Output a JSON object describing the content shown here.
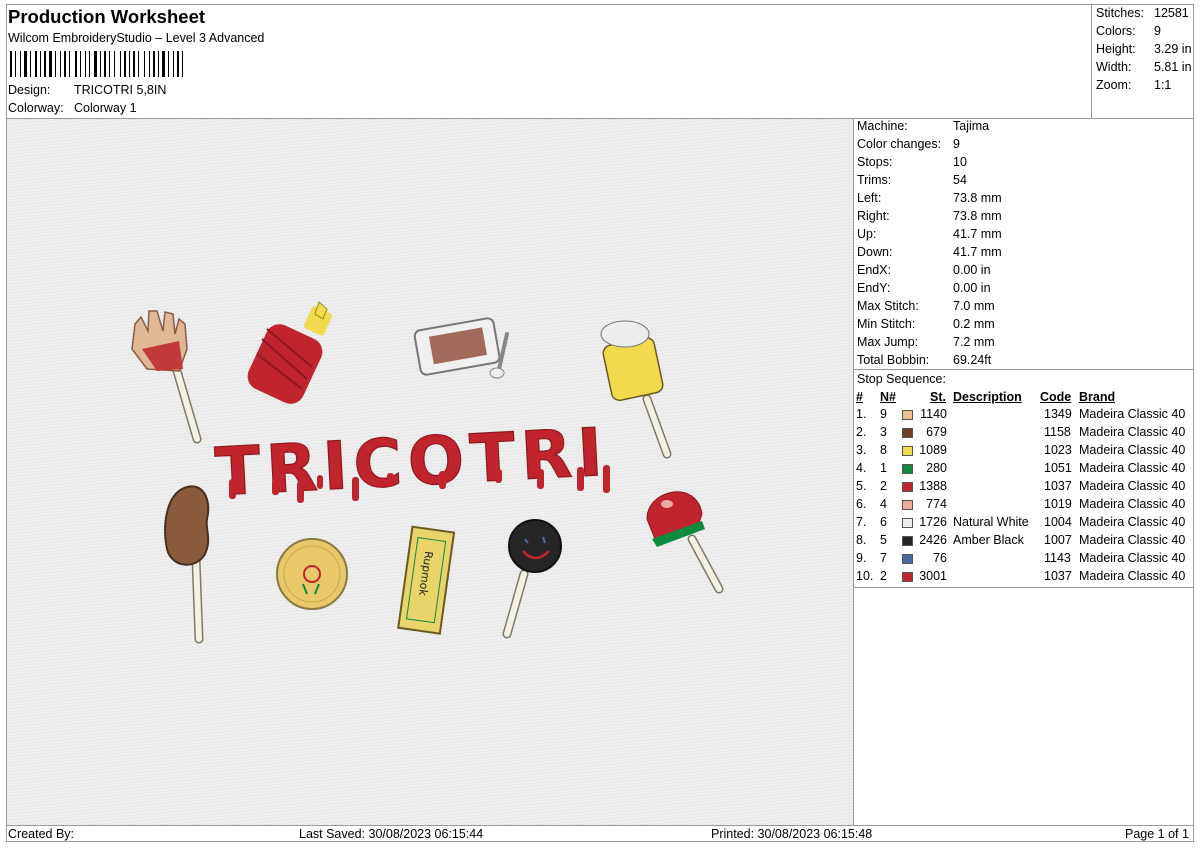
{
  "header": {
    "title": "Production Worksheet",
    "software": "Wilcom EmbroideryStudio – Level 3 Advanced",
    "design_label": "Design:",
    "design_value": "TRICOTRI 5,8IN",
    "colorway_label": "Colorway:",
    "colorway_value": "Colorway 1"
  },
  "summary": [
    {
      "label": "Stitches:",
      "value": "12581"
    },
    {
      "label": "Colors:",
      "value": "9"
    },
    {
      "label": "Height:",
      "value": "3.29 in"
    },
    {
      "label": "Width:",
      "value": "5.81 in"
    },
    {
      "label": "Zoom:",
      "value": "1:1"
    }
  ],
  "design_preview": {
    "text": "TRICOTRI",
    "brand_text": "Rupmok"
  },
  "machine_info": [
    {
      "label": "Machine:",
      "value": "Tajima"
    },
    {
      "label": "Color changes:",
      "value": "9"
    },
    {
      "label": "Stops:",
      "value": "10"
    },
    {
      "label": "Trims:",
      "value": "54"
    },
    {
      "label": "Left:",
      "value": "73.8 mm"
    },
    {
      "label": "Right:",
      "value": "73.8 mm"
    },
    {
      "label": "Up:",
      "value": "41.7 mm"
    },
    {
      "label": "Down:",
      "value": "41.7 mm"
    },
    {
      "label": "EndX:",
      "value": "0.00 in"
    },
    {
      "label": "EndY:",
      "value": "0.00 in"
    },
    {
      "label": "Max Stitch:",
      "value": "7.0 mm"
    },
    {
      "label": "Min Stitch:",
      "value": "0.2 mm"
    },
    {
      "label": "Max Jump:",
      "value": "7.2 mm"
    },
    {
      "label": "Total Bobbin:",
      "value": "69.24ft"
    }
  ],
  "stop_sequence": {
    "title": "Stop Sequence:",
    "headers": {
      "idx": "#",
      "n": "N#",
      "st": "St.",
      "desc": "Description",
      "code": "Code",
      "brand": "Brand"
    },
    "rows": [
      {
        "idx": "1.",
        "n": "9",
        "color": "#e8c48a",
        "st": "1140",
        "desc": "",
        "code": "1349",
        "brand": "Madeira Classic 40"
      },
      {
        "idx": "2.",
        "n": "3",
        "color": "#6b3f2a",
        "st": "679",
        "desc": "",
        "code": "1158",
        "brand": "Madeira Classic 40"
      },
      {
        "idx": "3.",
        "n": "8",
        "color": "#f2da4e",
        "st": "1089",
        "desc": "",
        "code": "1023",
        "brand": "Madeira Classic 40"
      },
      {
        "idx": "4.",
        "n": "1",
        "color": "#0e8a3e",
        "st": "280",
        "desc": "",
        "code": "1051",
        "brand": "Madeira Classic 40"
      },
      {
        "idx": "5.",
        "n": "2",
        "color": "#c0242d",
        "st": "1388",
        "desc": "",
        "code": "1037",
        "brand": "Madeira Classic 40"
      },
      {
        "idx": "6.",
        "n": "4",
        "color": "#f0a8a0",
        "st": "774",
        "desc": "",
        "code": "1019",
        "brand": "Madeira Classic 40"
      },
      {
        "idx": "7.",
        "n": "6",
        "color": "#ececec",
        "st": "1726",
        "desc": "Natural White",
        "code": "1004",
        "brand": "Madeira Classic 40"
      },
      {
        "idx": "8.",
        "n": "5",
        "color": "#262626",
        "st": "2426",
        "desc": "Amber Black",
        "code": "1007",
        "brand": "Madeira Classic 40"
      },
      {
        "idx": "9.",
        "n": "7",
        "color": "#4a6a9e",
        "st": "76",
        "desc": "",
        "code": "1143",
        "brand": "Madeira Classic 40"
      },
      {
        "idx": "10.",
        "n": "2",
        "color": "#c0242d",
        "st": "3001",
        "desc": "",
        "code": "1037",
        "brand": "Madeira Classic 40"
      }
    ]
  },
  "footer": {
    "created_by": "Created By:",
    "last_saved": "Last Saved: 30/08/2023 06:15:44",
    "printed": "Printed: 30/08/2023 06:15:48",
    "page": "Page 1 of 1"
  }
}
